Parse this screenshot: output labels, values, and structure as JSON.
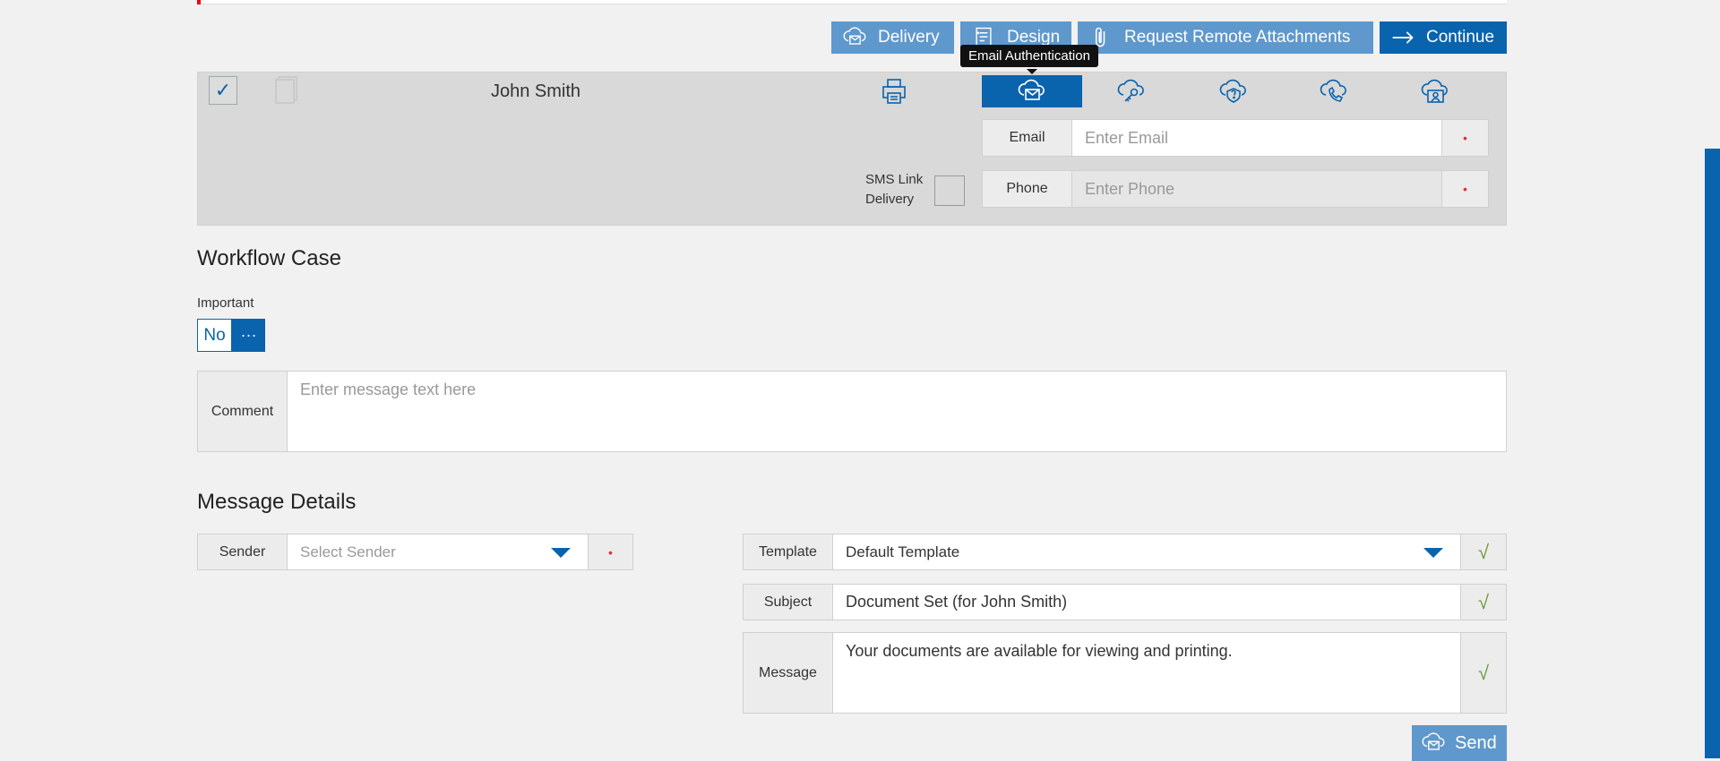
{
  "toolbar": {
    "delivery": "Delivery",
    "design": "Design",
    "request_remote": "Request Remote Attachments",
    "continue": "Continue"
  },
  "recipient": {
    "name": "John Smith",
    "tooltip": "Email Authentication",
    "auth_icons": [
      "print-icon",
      "cloud-mail-icon",
      "cloud-key-icon",
      "cloud-question-icon",
      "cloud-phone-icon",
      "cloud-user-icon"
    ],
    "email_label": "Email",
    "email_placeholder": "Enter Email",
    "phone_label": "Phone",
    "phone_placeholder": "Enter Phone",
    "sms_label_line1": "SMS Link",
    "sms_label_line2": "Delivery",
    "required_mark": "•"
  },
  "workflow": {
    "title": "Workflow Case",
    "important_label": "Important",
    "important_value": "No",
    "more": "···",
    "comment_label": "Comment",
    "comment_placeholder": "Enter message text here"
  },
  "message_details": {
    "title": "Message Details",
    "sender_label": "Sender",
    "sender_placeholder": "Select Sender",
    "template_label": "Template",
    "template_value": "Default Template",
    "subject_label": "Subject",
    "subject_value": "Document Set (for John Smith)",
    "message_label": "Message",
    "message_value": "Your documents are available for viewing and printing.",
    "check": "√",
    "send": "Send"
  },
  "colors": {
    "primary": "#0a63ad",
    "primary_light": "#5f98cc",
    "panel": "#d9d9d9",
    "background": "#f1f1f1"
  }
}
